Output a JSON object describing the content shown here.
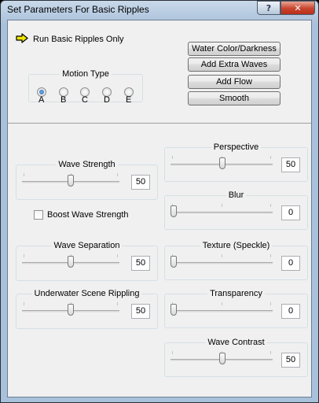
{
  "window": {
    "title": "Set Parameters For Basic Ripples"
  },
  "titlebar": {
    "help_label": "?",
    "close_label": "✕"
  },
  "run": {
    "label": "Run Basic Ripples Only",
    "icon": "arrow-right-icon",
    "arrow_color": "#f2e600"
  },
  "motion": {
    "legend": "Motion Type",
    "options": [
      "A",
      "B",
      "C",
      "D",
      "E"
    ],
    "selected": "A"
  },
  "buttons": {
    "water_color": "Water Color/Darkness",
    "extra_waves": "Add Extra Waves",
    "add_flow": "Add Flow",
    "smooth": "Smooth"
  },
  "wave_strength": {
    "label": "Wave Strength",
    "value": "50"
  },
  "boost": {
    "label": "Boost Wave Strength",
    "checked": false
  },
  "wave_separation": {
    "label": "Wave Separation",
    "value": "50"
  },
  "underwater": {
    "label": "Underwater Scene Rippling",
    "value": "50"
  },
  "perspective": {
    "label": "Perspective",
    "value": "50"
  },
  "blur": {
    "label": "Blur",
    "value": "0"
  },
  "texture": {
    "label": "Texture (Speckle)",
    "value": "0"
  },
  "transparency": {
    "label": "Transparency",
    "value": "0"
  },
  "wave_contrast": {
    "label": "Wave Contrast",
    "value": "50"
  }
}
